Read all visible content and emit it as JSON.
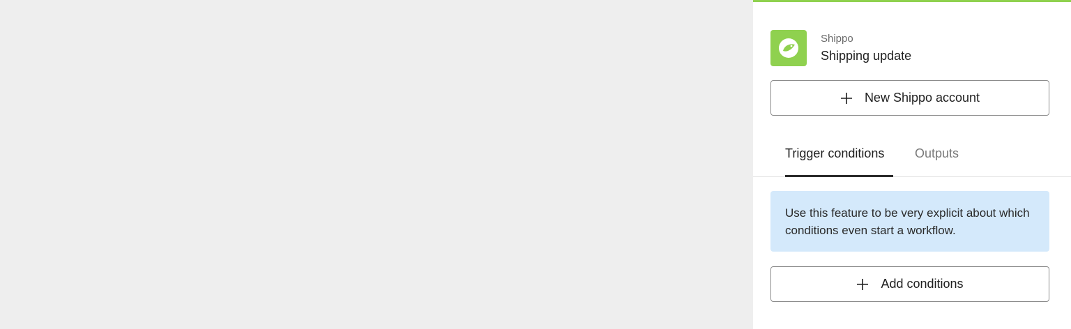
{
  "app": {
    "name": "Shippo",
    "trigger": "Shipping update",
    "logo_icon": "shippo-bird-icon",
    "accent_color": "#8fd14f"
  },
  "buttons": {
    "new_account": "New Shippo account",
    "add_conditions": "Add conditions",
    "plus_icon": "plus-icon"
  },
  "tabs": [
    {
      "label": "Trigger conditions",
      "active": true
    },
    {
      "label": "Outputs",
      "active": false
    }
  ],
  "info": {
    "text": "Use this feature to be very explicit about which conditions even start a workflow.",
    "background": "#d4e9fb"
  }
}
